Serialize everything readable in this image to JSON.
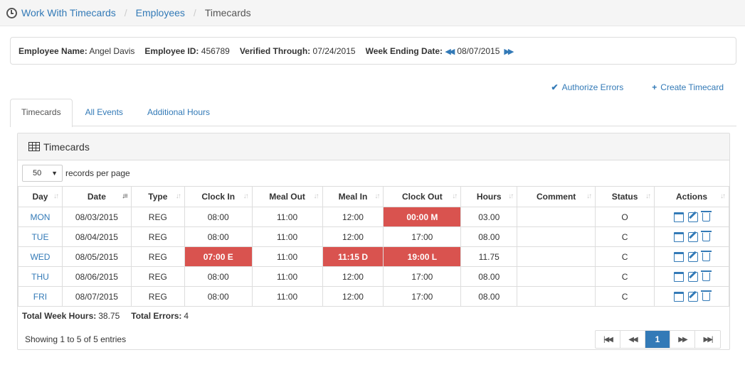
{
  "breadcrumb": {
    "items": [
      "Work With Timecards",
      "Employees"
    ],
    "current": "Timecards"
  },
  "employee": {
    "name_label": "Employee Name:",
    "name": "Angel Davis",
    "id_label": "Employee ID:",
    "id": "456789",
    "verified_label": "Verified Through:",
    "verified": "07/24/2015",
    "week_label": "Week Ending Date:",
    "week": "08/07/2015"
  },
  "actions": {
    "authorize": "Authorize Errors",
    "create": "Create Timecard"
  },
  "tabs": [
    "Timecards",
    "All Events",
    "Additional Hours"
  ],
  "panel": {
    "title": "Timecards",
    "page_length": "50",
    "records_label": "records per page"
  },
  "table": {
    "columns": [
      "Day",
      "Date",
      "Type",
      "Clock In",
      "Meal Out",
      "Meal In",
      "Clock Out",
      "Hours",
      "Comment",
      "Status",
      "Actions"
    ],
    "rows": [
      {
        "day": "MON",
        "date": "08/03/2015",
        "type": "REG",
        "clock_in": "08:00",
        "meal_out": "11:00",
        "meal_in": "12:00",
        "clock_out": "00:00 M",
        "hours": "03.00",
        "comment": "",
        "status": "O"
      },
      {
        "day": "TUE",
        "date": "08/04/2015",
        "type": "REG",
        "clock_in": "08:00",
        "meal_out": "11:00",
        "meal_in": "12:00",
        "clock_out": "17:00",
        "hours": "08.00",
        "comment": "",
        "status": "C"
      },
      {
        "day": "WED",
        "date": "08/05/2015",
        "type": "REG",
        "clock_in": "07:00 E",
        "meal_out": "11:00",
        "meal_in": "11:15 D",
        "clock_out": "19:00 L",
        "hours": "11.75",
        "comment": "",
        "status": "C"
      },
      {
        "day": "THU",
        "date": "08/06/2015",
        "type": "REG",
        "clock_in": "08:00",
        "meal_out": "11:00",
        "meal_in": "12:00",
        "clock_out": "17:00",
        "hours": "08.00",
        "comment": "",
        "status": "C"
      },
      {
        "day": "FRI",
        "date": "08/07/2015",
        "type": "REG",
        "clock_in": "08:00",
        "meal_out": "11:00",
        "meal_in": "12:00",
        "clock_out": "17:00",
        "hours": "08.00",
        "comment": "",
        "status": "C"
      }
    ]
  },
  "totals": {
    "hours_label": "Total Week Hours:",
    "hours": "38.75",
    "errors_label": "Total Errors:",
    "errors": "4"
  },
  "footer": {
    "info": "Showing 1 to 5 of 5 entries",
    "current_page": "1"
  },
  "colors": {
    "accent": "#337ab7",
    "error": "#d9534f"
  }
}
